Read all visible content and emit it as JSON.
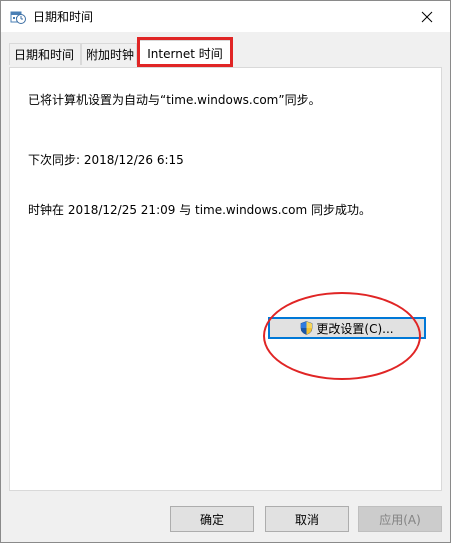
{
  "window": {
    "title": "日期和时间"
  },
  "tabs": [
    {
      "label": "日期和时间",
      "active": false
    },
    {
      "label": "附加时钟",
      "active": false
    },
    {
      "label": "Internet 时间",
      "active": true
    }
  ],
  "internet_time": {
    "sync_config_text": "已将计算机设置为自动与“time.windows.com”同步。",
    "next_sync_text": "下次同步: 2018/12/26 6:15",
    "last_sync_text": "时钟在 2018/12/25 21:09 与 time.windows.com 同步成功。",
    "change_settings_label": "更改设置(C)..."
  },
  "buttons": {
    "ok_label": "确定",
    "cancel_label": "取消",
    "apply_label": "应用(A)"
  },
  "colors": {
    "annotation": "#e02525",
    "focus_border": "#0078d7"
  },
  "icons": {
    "title": "clock-calendar-icon",
    "close": "close-icon",
    "change_settings": "uac-shield-icon"
  }
}
